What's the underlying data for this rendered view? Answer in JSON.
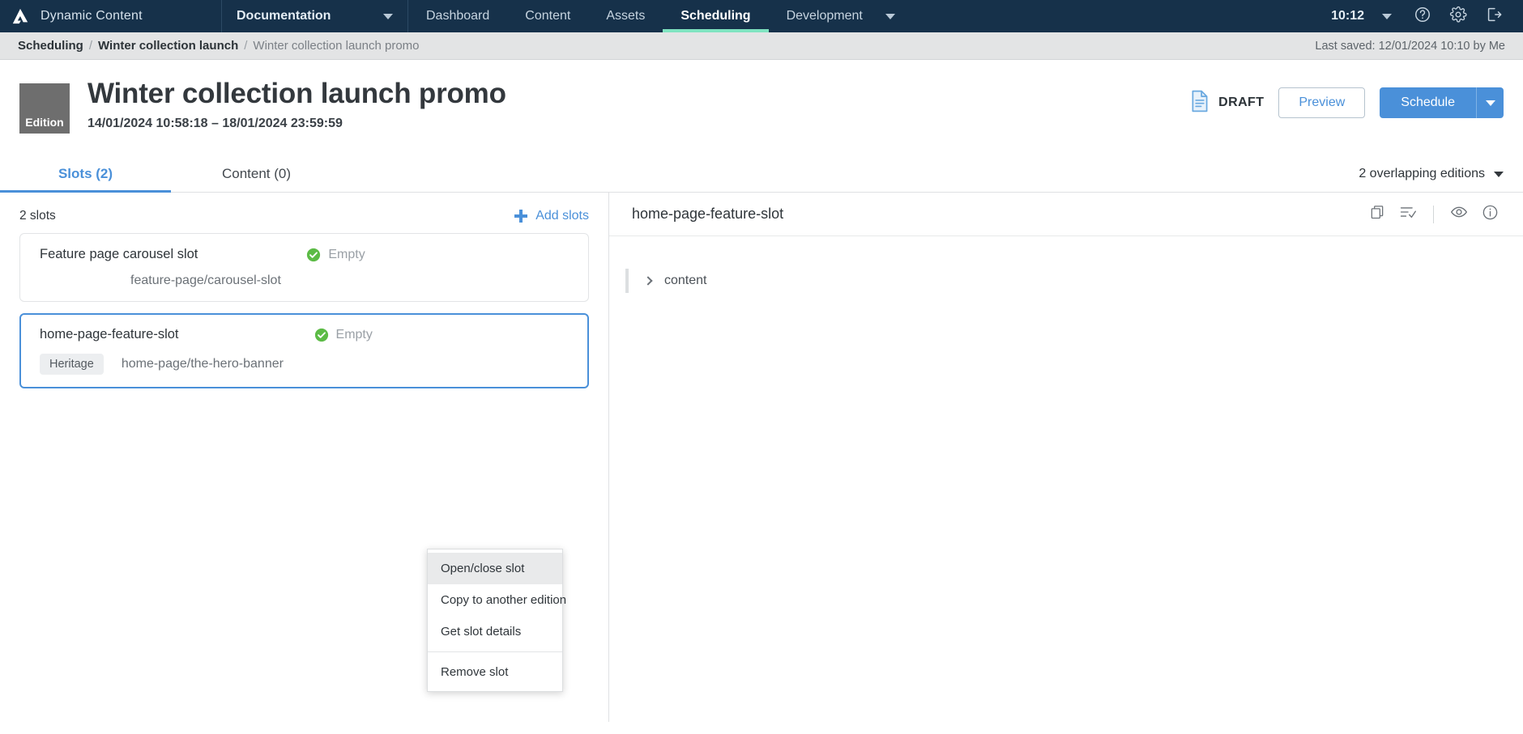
{
  "topnav": {
    "brand": "Dynamic Content",
    "logo_icon": "amplience-logo-icon",
    "dropdown": {
      "label": "Documentation",
      "icon": "chevron-down-icon"
    },
    "items": [
      {
        "label": "Dashboard",
        "active": false
      },
      {
        "label": "Content",
        "active": false
      },
      {
        "label": "Assets",
        "active": false
      },
      {
        "label": "Scheduling",
        "active": true
      },
      {
        "label": "Development",
        "active": false,
        "caret": true
      }
    ],
    "clock": "10:12",
    "clock_caret_icon": "chevron-down-icon",
    "help_icon": "help-circle-icon",
    "settings_icon": "gear-icon",
    "logout_icon": "logout-icon",
    "active_underline_color": "#7fe3c0",
    "background_color": "#16314a"
  },
  "breadcrumb": {
    "items": [
      "Scheduling",
      "Winter collection launch",
      "Winter collection launch promo"
    ],
    "separator": "/",
    "last_saved": "Last saved: 12/01/2024 10:10 by Me"
  },
  "title_area": {
    "badge_label": "Edition",
    "badge_color": "#6e6e6e",
    "title": "Winter collection launch promo",
    "dates": "14/01/2024 10:58:18  –  18/01/2024 23:59:59",
    "status_icon": "draft-document-icon",
    "status_label": "DRAFT",
    "preview_label": "Preview",
    "schedule_label": "Schedule",
    "schedule_caret_icon": "chevron-down-icon",
    "primary_color": "#4a90d9"
  },
  "tabs": [
    {
      "label": "Slots (2)",
      "active": true
    },
    {
      "label": "Content (0)",
      "active": false
    }
  ],
  "overlap": {
    "label": "2 overlapping editions",
    "icon": "chevron-down-icon"
  },
  "slots_panel": {
    "count_label": "2 slots",
    "add_label": "Add slots",
    "add_icon": "plus-icon",
    "cards": [
      {
        "name": "Feature page carousel slot",
        "status_icon": "check-circle-icon",
        "status": "Empty",
        "tag": null,
        "path": "feature-page/carousel-slot",
        "selected": false
      },
      {
        "name": "home-page-feature-slot",
        "status_icon": "check-circle-icon",
        "status": "Empty",
        "tag": "Heritage",
        "path": "home-page/the-hero-banner",
        "selected": true
      }
    ]
  },
  "context_menu": {
    "items": [
      {
        "label": "Open/close slot",
        "hover": true
      },
      {
        "label": "Copy to another edition",
        "hover": false
      },
      {
        "label": "Get slot details",
        "hover": false
      }
    ],
    "destructive": {
      "label": "Remove slot"
    }
  },
  "right_panel": {
    "title": "home-page-feature-slot",
    "icons": [
      {
        "name": "copy-icon"
      },
      {
        "name": "list-check-icon"
      },
      {
        "name": "eye-icon"
      },
      {
        "name": "info-icon"
      }
    ],
    "tree": [
      {
        "label": "content",
        "expanded": false,
        "chevron_icon": "chevron-right-icon"
      }
    ]
  }
}
